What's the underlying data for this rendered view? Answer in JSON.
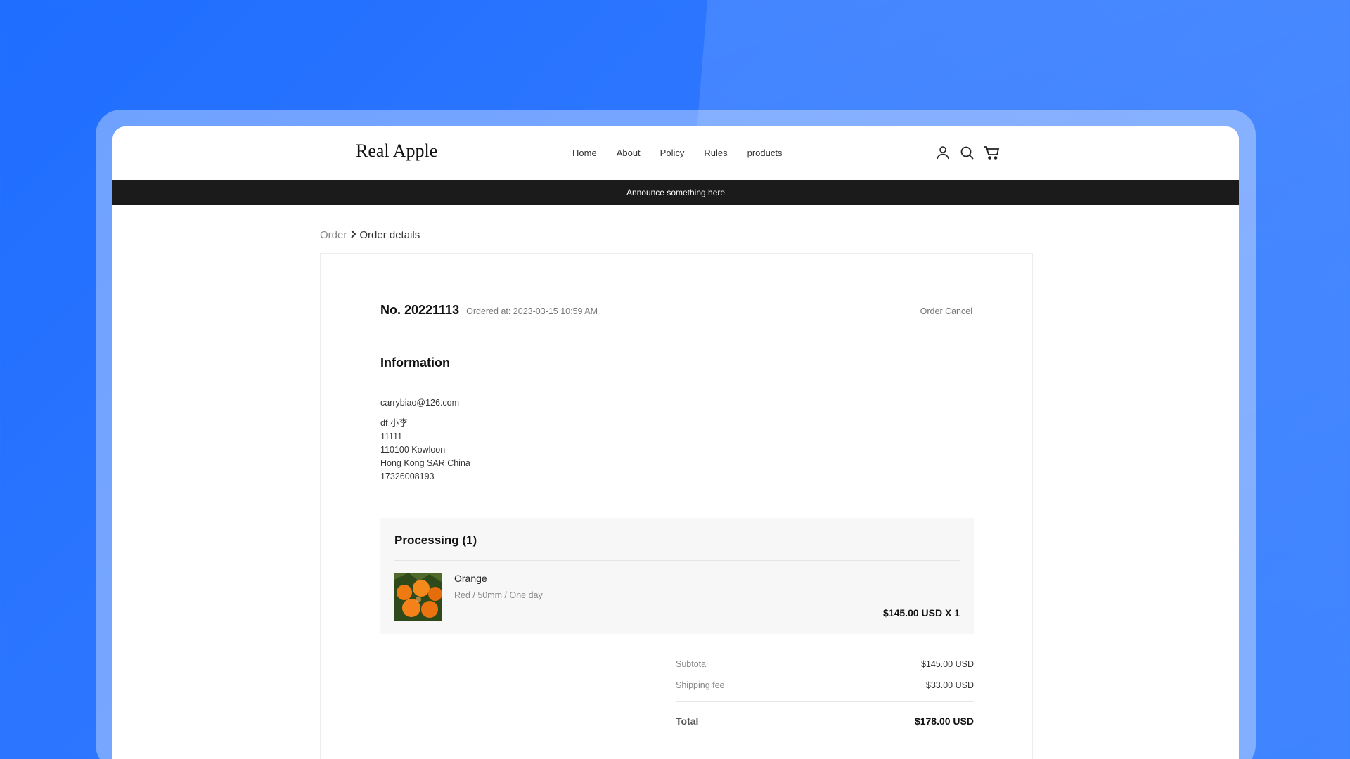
{
  "header": {
    "logo": "Real Apple",
    "nav": [
      "Home",
      "About",
      "Policy",
      "Rules",
      "products"
    ],
    "icons": [
      "user-icon",
      "search-icon",
      "cart-icon"
    ]
  },
  "announcement": "Announce something here",
  "breadcrumb": {
    "parent": "Order",
    "current": "Order details"
  },
  "order": {
    "number": "No. 20221113",
    "ordered_at": "Ordered at: 2023-03-15 10:59 AM",
    "cancel_label": "Order Cancel"
  },
  "information": {
    "title": "Information",
    "email": "carrybiao@126.com",
    "name": "df 小李",
    "line2": "11111",
    "line3": "110100 Kowloon",
    "line4": "Hong Kong SAR China",
    "phone": "17326008193"
  },
  "processing": {
    "title": "Processing (1)",
    "item": {
      "name": "Orange",
      "variant": "Red / 50mm / One day",
      "price": "$145.00 USD X 1"
    }
  },
  "totals": {
    "subtotal_label": "Subtotal",
    "subtotal_value": "$145.00 USD",
    "shipping_label": "Shipping fee",
    "shipping_value": "$33.00 USD",
    "total_label": "Total",
    "total_value": "$178.00 USD"
  }
}
